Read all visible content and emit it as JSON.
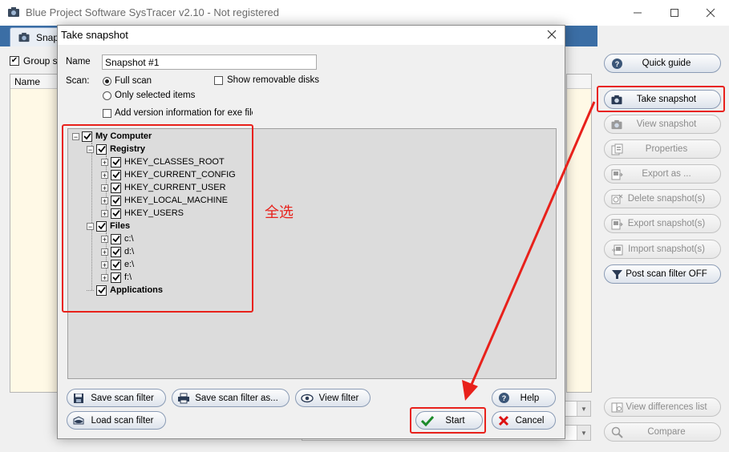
{
  "window": {
    "title": "Blue Project Software SysTracer v2.10 - Not registered",
    "icon": "camera-icon"
  },
  "main": {
    "tab_label": "Snapshots",
    "group_label": "Group snapshots",
    "list_header": "Name"
  },
  "right_buttons": [
    {
      "name": "quick-guide-button",
      "label": "Quick guide",
      "icon": "help-icon",
      "enabled": true
    },
    {
      "name": "take-snapshot-button",
      "label": "Take snapshot",
      "icon": "camera-icon",
      "enabled": true
    },
    {
      "name": "view-snapshot-button",
      "label": "View snapshot",
      "icon": "camera-icon",
      "enabled": false
    },
    {
      "name": "properties-button",
      "label": "Properties",
      "icon": "properties-icon",
      "enabled": false
    },
    {
      "name": "export-as-button",
      "label": "Export as ...",
      "icon": "export-icon",
      "enabled": false
    },
    {
      "name": "delete-snapshots-button",
      "label": "Delete snapshot(s)",
      "icon": "delete-icon",
      "enabled": false
    },
    {
      "name": "export-snapshots-button",
      "label": "Export snapshot(s)",
      "icon": "export-icon",
      "enabled": false
    },
    {
      "name": "import-snapshots-button",
      "label": "Import snapshot(s)",
      "icon": "import-icon",
      "enabled": false
    },
    {
      "name": "post-scan-filter-button",
      "label": "Post scan filter OFF",
      "icon": "filter-icon",
      "enabled": true
    },
    {
      "name": "view-differences-button",
      "label": "View differences list",
      "icon": "compare-icon",
      "enabled": false
    },
    {
      "name": "compare-button",
      "label": "Compare",
      "icon": "search-icon",
      "enabled": false
    }
  ],
  "dialog": {
    "title": "Take snapshot",
    "name_label": "Name",
    "name_value": "Snapshot #1",
    "scan_label": "Scan:",
    "full_scan": "Full scan",
    "only_selected": "Only selected items",
    "show_removable": "Show removable disks",
    "add_version": "Add version information for exe files",
    "tree": {
      "root": "My Computer",
      "registry": "Registry",
      "hives": [
        "HKEY_CLASSES_ROOT",
        "HKEY_CURRENT_CONFIG",
        "HKEY_CURRENT_USER",
        "HKEY_LOCAL_MACHINE",
        "HKEY_USERS"
      ],
      "files": "Files",
      "drives": [
        "c:\\",
        "d:\\",
        "e:\\",
        "f:\\"
      ],
      "applications": "Applications"
    },
    "buttons": {
      "save_filter": "Save scan filter",
      "save_filter_as": "Save scan filter as...",
      "view_filter": "View filter",
      "load_filter": "Load scan filter",
      "help": "Help",
      "start": "Start",
      "cancel": "Cancel"
    }
  },
  "annotation": {
    "text": "全选",
    "color": "#e8211b"
  }
}
